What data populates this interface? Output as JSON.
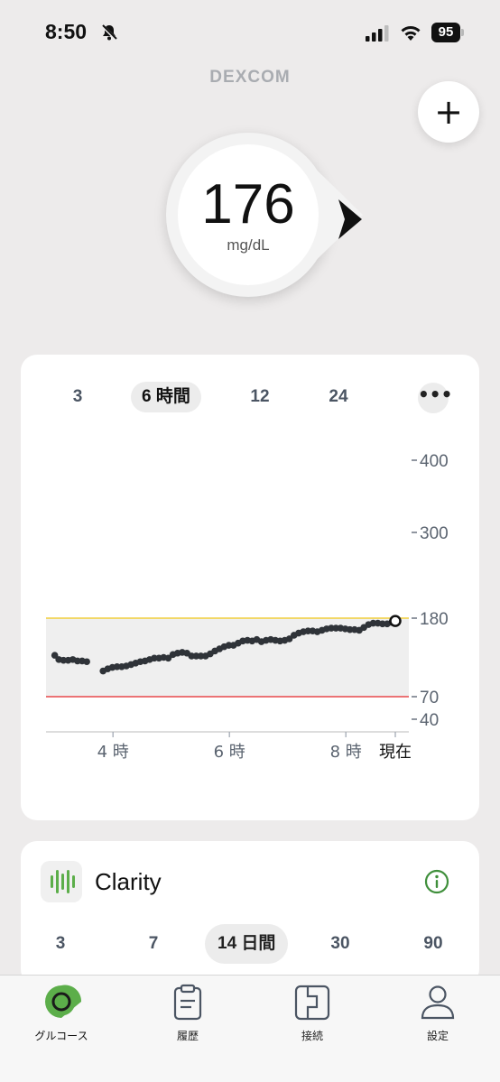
{
  "status_bar": {
    "time": "8:50",
    "battery": "95"
  },
  "brand": "DEXCOM",
  "glucose": {
    "value": "176",
    "unit": "mg/dL",
    "trend": "steady-right"
  },
  "chart_card": {
    "range_tabs": [
      "3",
      "6 時間",
      "12",
      "24"
    ],
    "active_range": "6 時間",
    "more_label": "•••"
  },
  "chart_data": {
    "type": "scatter",
    "x_unit": "hour",
    "x_ticks": [
      {
        "x": 4,
        "label": "4 時"
      },
      {
        "x": 6,
        "label": "6 時"
      },
      {
        "x": 8,
        "label": "8 時"
      },
      {
        "x": 8.85,
        "label": "現在"
      }
    ],
    "y_ticks": [
      {
        "y": 400,
        "label": "400"
      },
      {
        "y": 300,
        "label": "300"
      },
      {
        "y": 180,
        "label": "180"
      },
      {
        "y": 70,
        "label": "70"
      },
      {
        "y": 40,
        "label": "40"
      }
    ],
    "xlim": [
      2.85,
      8.85
    ],
    "target_range": {
      "low": 70,
      "high": 180
    },
    "colors": {
      "high_line": "#f2cf3d",
      "low_line": "#e8484b",
      "range_fill": "#efefef",
      "points": "#2f3338"
    },
    "current": {
      "x": 8.85,
      "y": 176
    },
    "points": [
      [
        3.0,
        128
      ],
      [
        3.07,
        122
      ],
      [
        3.15,
        121
      ],
      [
        3.23,
        121
      ],
      [
        3.31,
        122
      ],
      [
        3.39,
        120
      ],
      [
        3.47,
        120
      ],
      [
        3.55,
        119
      ],
      [
        3.83,
        106
      ],
      [
        3.91,
        109
      ],
      [
        3.99,
        111
      ],
      [
        4.07,
        112
      ],
      [
        4.15,
        112
      ],
      [
        4.23,
        113
      ],
      [
        4.31,
        115
      ],
      [
        4.39,
        117
      ],
      [
        4.47,
        119
      ],
      [
        4.55,
        120
      ],
      [
        4.63,
        122
      ],
      [
        4.71,
        124
      ],
      [
        4.79,
        124
      ],
      [
        4.87,
        125
      ],
      [
        4.95,
        124
      ],
      [
        5.03,
        129
      ],
      [
        5.11,
        131
      ],
      [
        5.19,
        132
      ],
      [
        5.27,
        131
      ],
      [
        5.35,
        127
      ],
      [
        5.43,
        127
      ],
      [
        5.51,
        127
      ],
      [
        5.59,
        127
      ],
      [
        5.67,
        130
      ],
      [
        5.75,
        134
      ],
      [
        5.83,
        137
      ],
      [
        5.91,
        140
      ],
      [
        5.99,
        142
      ],
      [
        6.07,
        142
      ],
      [
        6.15,
        145
      ],
      [
        6.23,
        148
      ],
      [
        6.31,
        149
      ],
      [
        6.39,
        148
      ],
      [
        6.47,
        150
      ],
      [
        6.55,
        147
      ],
      [
        6.63,
        149
      ],
      [
        6.71,
        150
      ],
      [
        6.79,
        149
      ],
      [
        6.87,
        148
      ],
      [
        6.95,
        149
      ],
      [
        7.03,
        151
      ],
      [
        7.11,
        156
      ],
      [
        7.19,
        159
      ],
      [
        7.27,
        161
      ],
      [
        7.35,
        162
      ],
      [
        7.43,
        162
      ],
      [
        7.51,
        161
      ],
      [
        7.59,
        163
      ],
      [
        7.67,
        165
      ],
      [
        7.75,
        166
      ],
      [
        7.83,
        166
      ],
      [
        7.91,
        166
      ],
      [
        7.99,
        165
      ],
      [
        8.07,
        164
      ],
      [
        8.15,
        164
      ],
      [
        8.23,
        163
      ],
      [
        8.31,
        167
      ],
      [
        8.39,
        171
      ],
      [
        8.47,
        173
      ],
      [
        8.55,
        173
      ],
      [
        8.63,
        172
      ],
      [
        8.71,
        172
      ],
      [
        8.79,
        174
      ]
    ]
  },
  "clarity": {
    "title": "Clarity",
    "periods": [
      "3",
      "7",
      "14 日間",
      "30",
      "90"
    ],
    "active_period": "14 日間"
  },
  "bottom_nav": [
    {
      "label": "グルコース",
      "icon": "glucose-icon",
      "active": true
    },
    {
      "label": "履歴",
      "icon": "clipboard-icon",
      "active": false
    },
    {
      "label": "接続",
      "icon": "connection-icon",
      "active": false
    },
    {
      "label": "設定",
      "icon": "user-icon",
      "active": false
    }
  ]
}
